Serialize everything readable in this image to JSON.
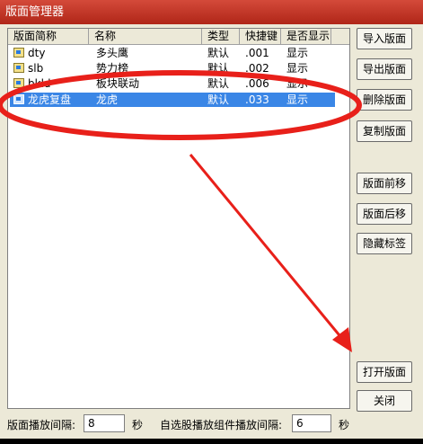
{
  "window": {
    "title": "版面管理器"
  },
  "columns": [
    "版面简称",
    "名称",
    "类型",
    "快捷键",
    "是否显示"
  ],
  "rows": [
    {
      "short": "dty",
      "name": "多头鹰",
      "type": "默认",
      "hotkey": ".001",
      "show": "显示",
      "selected": false
    },
    {
      "short": "slb",
      "name": "势力榜",
      "type": "默认",
      "hotkey": ".002",
      "show": "显示",
      "selected": false
    },
    {
      "short": "bkld",
      "name": "板块联动",
      "type": "默认",
      "hotkey": ".006",
      "show": "显示",
      "selected": false
    },
    {
      "short": "龙虎复盘",
      "name": "龙虎",
      "type": "默认",
      "hotkey": ".033",
      "show": "显示",
      "selected": true
    }
  ],
  "buttons": {
    "import": "导入版面",
    "export": "导出版面",
    "delete": "删除版面",
    "copy": "复制版面",
    "move_up": "版面前移",
    "move_down": "版面后移",
    "hide_tab": "隐藏标签",
    "open": "打开版面",
    "close": "关闭"
  },
  "bottom": {
    "interval_label": "版面播放间隔:",
    "interval_value": "8",
    "interval_unit": "秒",
    "stock_interval_label": "自选股播放组件播放间隔:",
    "stock_interval_value": "6",
    "stock_interval_unit": "秒"
  },
  "colors": {
    "selection": "#3a86e6",
    "annotation": "#e8201a"
  }
}
